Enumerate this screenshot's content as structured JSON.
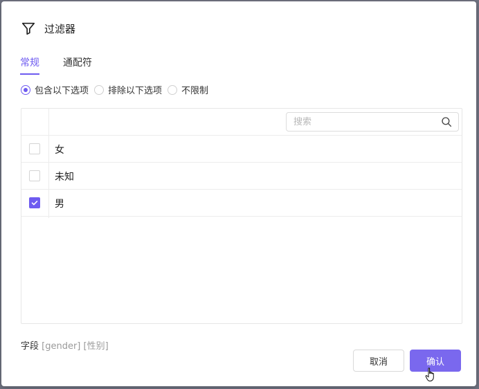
{
  "dialog": {
    "title": "过滤器",
    "icon": "filter-icon"
  },
  "tabs": [
    {
      "label": "常规",
      "active": true
    },
    {
      "label": "通配符",
      "active": false
    }
  ],
  "mode_options": [
    {
      "label": "包含以下选项",
      "checked": true
    },
    {
      "label": "排除以下选项",
      "checked": false
    },
    {
      "label": "不限制",
      "checked": false
    }
  ],
  "search": {
    "placeholder": "搜索",
    "value": ""
  },
  "options": [
    {
      "label": "女",
      "checked": false
    },
    {
      "label": "未知",
      "checked": false
    },
    {
      "label": "男",
      "checked": true
    }
  ],
  "field_info": {
    "prefix": "字段",
    "field_name": "[gender]",
    "field_label": "[性别]"
  },
  "buttons": {
    "cancel": "取消",
    "confirm": "确认"
  },
  "colors": {
    "accent": "#6e5bf0",
    "confirm_bg": "#7a68ee"
  }
}
